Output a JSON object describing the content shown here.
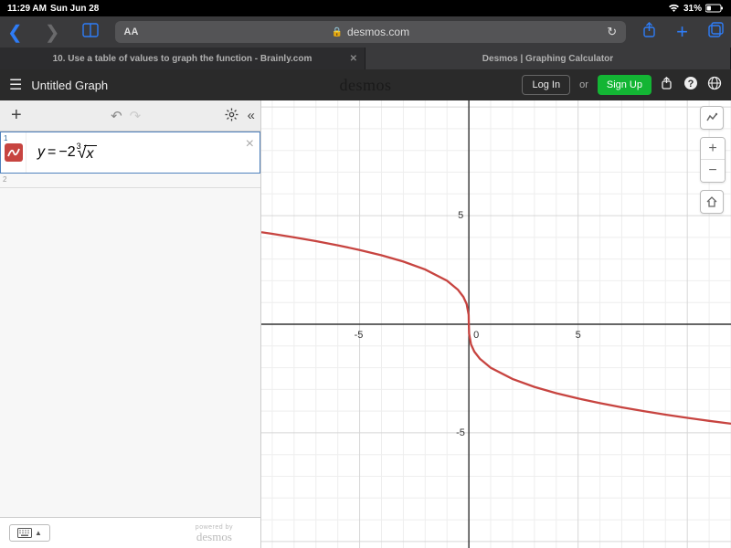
{
  "status": {
    "time": "11:29 AM",
    "date": "Sun Jun 28",
    "battery": "31%"
  },
  "safari": {
    "url_host": "desmos.com",
    "aa": "AA"
  },
  "tabs": [
    {
      "label": "10. Use a table of values to graph the function - Brainly.com"
    },
    {
      "label": "Desmos | Graphing Calculator"
    }
  ],
  "desmos": {
    "title": "Untitled Graph",
    "logo": "desmos",
    "login": "Log In",
    "or": "or",
    "signup": "Sign Up"
  },
  "expression": {
    "index": "1",
    "raw": "y = -2·cbrt(x)",
    "coef": "2",
    "root_index": "3",
    "radicand": "x",
    "empty_index": "2"
  },
  "footer": {
    "powered_small": "powered by",
    "powered_logo": "desmos"
  },
  "axes": {
    "x_neg": "-5",
    "x_zero": "0",
    "x_pos": "5",
    "y_pos": "5",
    "y_neg": "-5"
  },
  "chart_data": {
    "type": "line",
    "title": "",
    "expression": "y = -2 * x^(1/3)",
    "xlim": [
      -9.5,
      12
    ],
    "ylim": [
      -10.3,
      10.3
    ],
    "series": [
      {
        "name": "y = -2∛x",
        "color": "#c74440",
        "x": [
          -9.5,
          -9,
          -8,
          -7,
          -6,
          -5,
          -4,
          -3,
          -2,
          -1,
          -0.5,
          -0.25,
          -0.1,
          -0.01,
          0,
          0.01,
          0.1,
          0.25,
          0.5,
          1,
          2,
          3,
          4,
          5,
          6,
          7,
          8,
          9,
          10,
          11,
          12
        ],
        "y": [
          4.236,
          4.16,
          4.0,
          3.826,
          3.634,
          3.42,
          3.175,
          2.884,
          2.52,
          2.0,
          1.587,
          1.26,
          0.928,
          0.431,
          0.0,
          -0.431,
          -0.928,
          -1.26,
          -1.587,
          -2.0,
          -2.52,
          -2.884,
          -3.175,
          -3.42,
          -3.634,
          -3.826,
          -4.0,
          -4.16,
          -4.309,
          -4.448,
          -4.579
        ]
      }
    ],
    "xlabel": "",
    "ylabel": ""
  }
}
